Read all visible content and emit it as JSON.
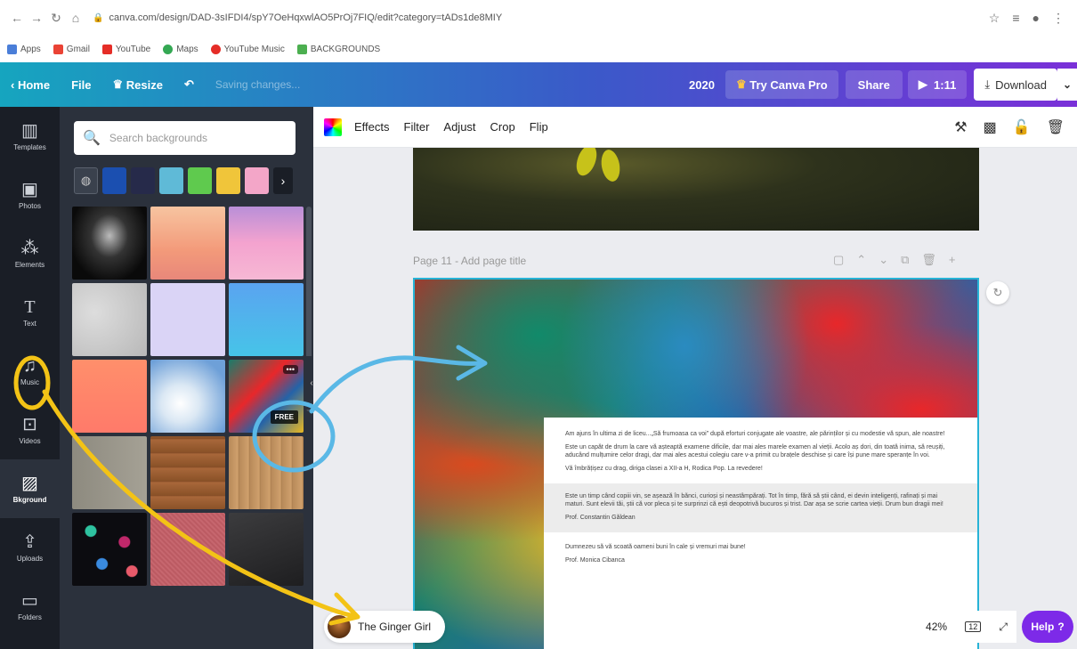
{
  "browser": {
    "url": "canva.com/design/DAD-3sIFDI4/spY7OeHqxwlAO5PrOj7FIQ/edit?category=tADs1de8MIY",
    "bookmarks": [
      "Apps",
      "Gmail",
      "YouTube",
      "Maps",
      "YouTube Music",
      "BACKGROUNDS"
    ]
  },
  "toolbar": {
    "home": "Home",
    "file": "File",
    "resize": "Resize",
    "saving": "Saving changes...",
    "year": "2020",
    "try_pro": "Try Canva Pro",
    "share": "Share",
    "duration": "1:11",
    "download": "Download"
  },
  "rail": [
    {
      "label": "Templates",
      "icon": "template-icon"
    },
    {
      "label": "Photos",
      "icon": "photo-icon"
    },
    {
      "label": "Elements",
      "icon": "elements-icon"
    },
    {
      "label": "Text",
      "icon": "text-icon"
    },
    {
      "label": "Music",
      "icon": "music-icon"
    },
    {
      "label": "Videos",
      "icon": "video-icon"
    },
    {
      "label": "Bkground",
      "icon": "background-icon"
    },
    {
      "label": "Uploads",
      "icon": "upload-icon"
    },
    {
      "label": "Folders",
      "icon": "folder-icon"
    }
  ],
  "panel": {
    "search_placeholder": "Search backgrounds",
    "swatch_colors": [
      "#1b4fb0",
      "#262a4a",
      "#5fbad7",
      "#5fca4e",
      "#f0c53a",
      "#f3a6c8"
    ],
    "free_badge": "FREE"
  },
  "editor": {
    "actions": [
      "Effects",
      "Filter",
      "Adjust",
      "Crop",
      "Flip"
    ],
    "page_label": "Page 11 - Add page title"
  },
  "page_text": {
    "p1": "Am ajuns în ultima zi de liceu...„Să frumoasa ca voi” după eforturi conjugate ale voastre, ale părinților și cu modestie vă spun, ale noastre!",
    "p2": "Este un capăt de drum la care vă așteaptă examene dificile, dar mai ales marele examen al vieții. Acolo aș dori, din toată inima, să reușiți, aducând mulțumire celor dragi, dar mai ales acestui colegiu care v-a primit cu brațele deschise și care își pune mare speranțe în voi.",
    "p3": "Vă îmbrățișez cu drag, diriga clasei a XII-a H, Rodica Pop. La revedere!",
    "p4": "Este un timp când copiii vin, se așează în bănci, curioși și neastâmpărați. Tot în timp, fără să știi când, ei devin inteligenți, rafinați și mai maturi. Sunt elevii tăi, știi că vor pleca și te surprinzi că ești deopotrivă bucuros și trist. Dar așa se scrie cartea vieții. Drum bun dragii mei!",
    "p5": "Prof. Constantin Găldean",
    "p6": "Dumnezeu să vă scoată oameni buni în cale și vremuri mai bune!",
    "p7": "Prof. Monica Cibanca"
  },
  "bottom": {
    "user_name": "The Ginger Girl",
    "zoom": "42%",
    "page_count": "12",
    "help": "Help"
  }
}
